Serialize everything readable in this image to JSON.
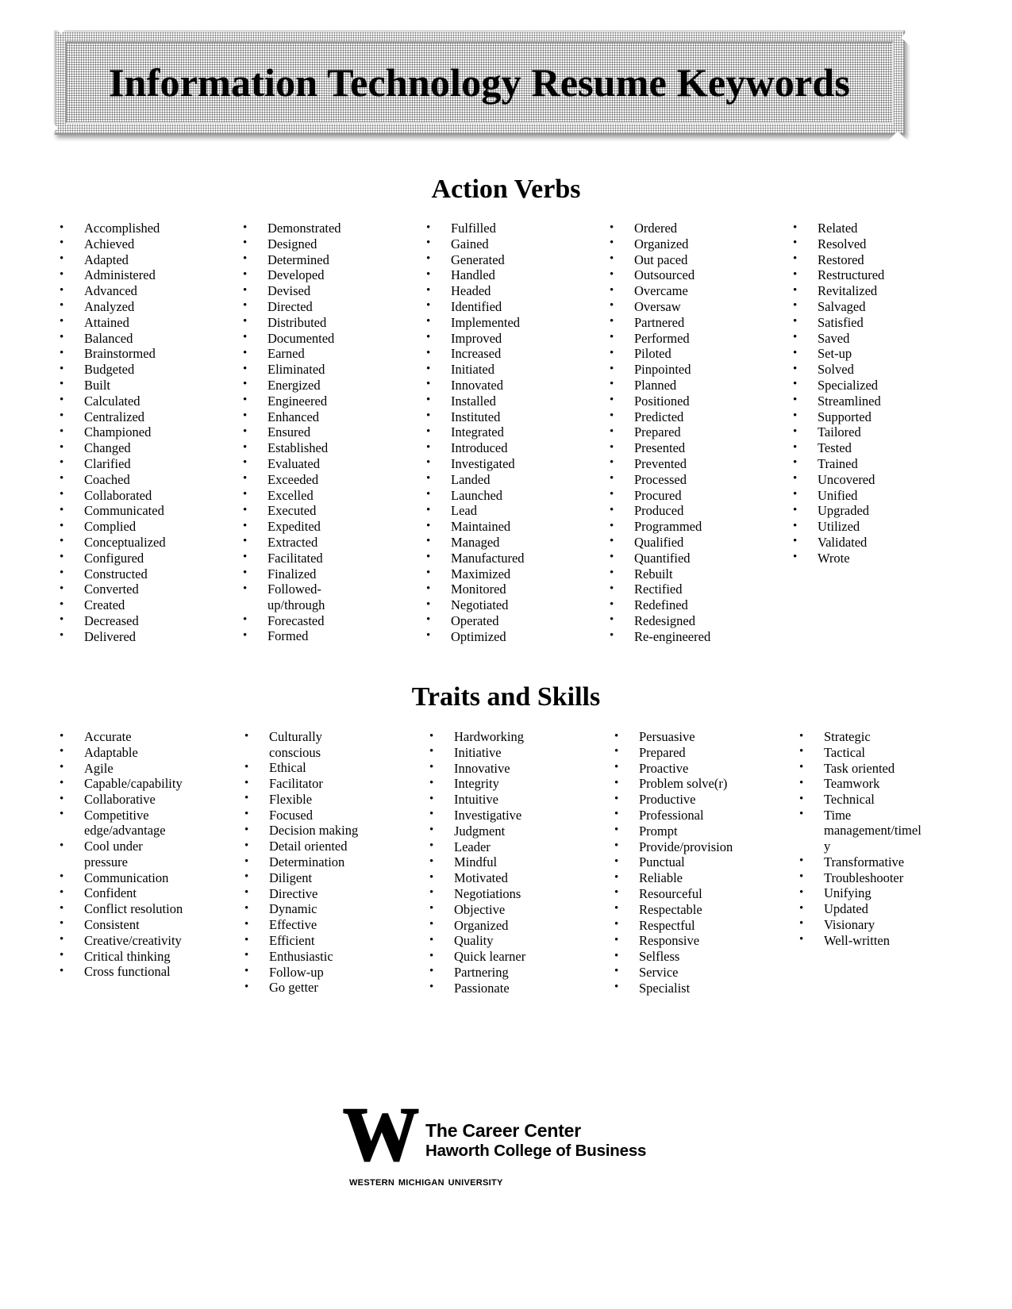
{
  "document": {
    "title": "Information Technology Resume Keywords"
  },
  "sections": [
    {
      "id": "action-verbs",
      "heading": "Action Verbs",
      "columns": [
        {
          "items": [
            "Accomplished",
            "Achieved",
            "Adapted",
            "Administered",
            "Advanced",
            "Analyzed",
            "Attained",
            "Balanced",
            "Brainstormed",
            "Budgeted",
            "Built",
            "Calculated",
            "Centralized",
            "Championed",
            "Changed",
            "Clarified",
            "Coached",
            "Collaborated",
            "Communicated",
            "Complied",
            "Conceptualized",
            "Configured",
            "Constructed",
            "Converted",
            "Created",
            "Decreased",
            "Delivered"
          ]
        },
        {
          "items": [
            "Demonstrated",
            "Designed",
            "Determined",
            "Developed",
            "Devised",
            "Directed",
            "Distributed",
            "Documented",
            "Earned",
            "Eliminated",
            "Energized",
            "Engineered",
            "Enhanced",
            "Ensured",
            "Established",
            "Evaluated",
            "Exceeded",
            "Excelled",
            "Executed",
            "Expedited",
            "Extracted",
            "Facilitated",
            "Finalized",
            "Followed-\nup/through",
            "Forecasted",
            "Formed"
          ]
        },
        {
          "items": [
            "Fulfilled",
            "Gained",
            "Generated",
            "Handled",
            "Headed",
            "Identified",
            "Implemented",
            "Improved",
            "Increased",
            "Initiated",
            "Innovated",
            "Installed",
            "Instituted",
            "Integrated",
            "Introduced",
            "Investigated",
            "Landed",
            "Launched",
            "Lead",
            "Maintained",
            "Managed",
            "Manufactured",
            "Maximized",
            "Monitored",
            "Negotiated",
            "Operated",
            "Optimized"
          ]
        },
        {
          "items": [
            "Ordered",
            "Organized",
            "Out paced",
            "Outsourced",
            "Overcame",
            "Oversaw",
            "Partnered",
            "Performed",
            "Piloted",
            "Pinpointed",
            "Planned",
            "Positioned",
            "Predicted",
            "Prepared",
            "Presented",
            "Prevented",
            "Processed",
            "Procured",
            "Produced",
            "Programmed",
            "Qualified",
            "Quantified",
            "Rebuilt",
            "Rectified",
            "Redefined",
            "Redesigned",
            "Re-engineered"
          ]
        },
        {
          "items": [
            "Related",
            "Resolved",
            "Restored",
            "Restructured",
            "Revitalized",
            "Salvaged",
            "Satisfied",
            "Saved",
            "Set-up",
            "Solved",
            "Specialized",
            "Streamlined",
            "Supported",
            "Tailored",
            "Tested",
            "Trained",
            "Uncovered",
            "Unified",
            "Upgraded",
            "Utilized",
            "Validated",
            "Wrote"
          ]
        }
      ]
    },
    {
      "id": "traits-and-skills",
      "heading": "Traits and Skills",
      "columns": [
        {
          "items": [
            "Accurate",
            "Adaptable",
            "Agile",
            "Capable/capability",
            "Collaborative",
            "Competitive\nedge/advantage",
            "Cool under\npressure",
            "Communication",
            "Confident",
            "Conflict resolution",
            "Consistent",
            "Creative/creativity",
            "Critical thinking",
            "Cross functional"
          ]
        },
        {
          "items": [
            "Culturally\nconscious",
            "Ethical",
            "Facilitator",
            "Flexible",
            "Focused",
            "Decision making",
            "Detail oriented",
            "Determination",
            "Diligent",
            "Directive",
            "Dynamic",
            "Effective",
            "Efficient",
            "Enthusiastic",
            "Follow-up",
            "Go getter"
          ]
        },
        {
          "items": [
            "Hardworking",
            "Initiative",
            "Innovative",
            "Integrity",
            "Intuitive",
            "Investigative",
            "Judgment",
            "Leader",
            "Mindful",
            "Motivated",
            "Negotiations",
            "Objective",
            "Organized",
            "Quality",
            "Quick learner",
            "Partnering",
            "Passionate"
          ]
        },
        {
          "items": [
            "Persuasive",
            "Prepared",
            "Proactive",
            "Problem solve(r)",
            "Productive",
            "Professional",
            "Prompt",
            "Provide/provision",
            "Punctual",
            "Reliable",
            "Resourceful",
            "Respectable",
            "Respectful",
            "Responsive",
            "Selfless",
            "Service",
            "Specialist"
          ]
        },
        {
          "items": [
            "Strategic",
            "Tactical",
            "Task oriented",
            "Teamwork",
            "Technical",
            "Time\nmanagement/timel\ny",
            "Transformative",
            "Troubleshooter",
            "Unifying",
            "Updated",
            "Visionary",
            "Well-written"
          ]
        }
      ]
    }
  ],
  "footer": {
    "logo_mark": "W",
    "line1": "The Career Center",
    "line2": "Haworth College of Business",
    "university": "Western Michigan University"
  }
}
